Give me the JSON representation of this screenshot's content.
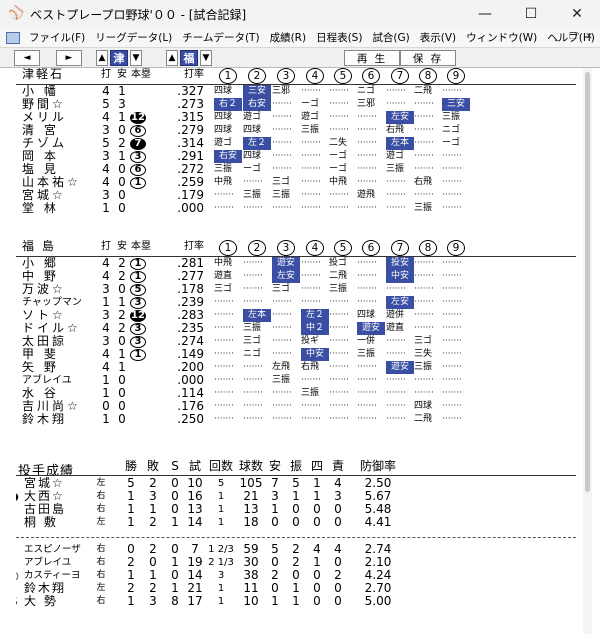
{
  "window": {
    "title": "ベストプレープロ野球'００ - [試合記録]",
    "icon": "baseball-cap-icon",
    "controls": [
      "minimize-icon",
      "maximize-icon",
      "close-icon"
    ]
  },
  "menu": [
    "ファイル(F)",
    "リーグデータ(L)",
    "チームデータ(T)",
    "成績(R)",
    "日程表(S)",
    "試合(G)",
    "表示(V)",
    "ウィンドウ(W)",
    "ヘルプ(H)"
  ],
  "toolbar": {
    "prev": "◄",
    "next": "►",
    "team1_arrow_up": "▲",
    "team1": "津",
    "team1_arrow_down": "▼",
    "team2_arrow_up": "▲",
    "team2": "福",
    "team2_arrow_down": "▼",
    "replay": "再 生",
    "save": "保 存"
  },
  "batting_headers": {
    "ab": "打",
    "h": "安",
    "hr": "本塁",
    "avg": "打率",
    "innings": [
      "1",
      "2",
      "3",
      "4",
      "5",
      "6",
      "7",
      "8",
      "9"
    ]
  },
  "team1": {
    "name": "津軽石",
    "players": [
      {
        "name": "小 幡",
        "ab": "4",
        "h": "1",
        "hr": "",
        "avg": ".327",
        "inn": [
          "四球",
          "三安",
          "三邪",
          "",
          "",
          "ニゴ",
          "",
          "二飛",
          ""
        ]
      },
      {
        "name": "野間☆",
        "ab": "5",
        "h": "3",
        "hr": "",
        "avg": ".273",
        "inn": [
          "右２",
          "右安",
          "",
          "ーゴ",
          "",
          "三邪",
          "",
          "",
          "三安"
        ]
      },
      {
        "name": "メリル",
        "ab": "4",
        "h": "1",
        "hr": "12",
        "avg": ".315",
        "inn": [
          "四球",
          "遊ゴ",
          "",
          "遊ゴ",
          "",
          "",
          "左安",
          "",
          "三振"
        ]
      },
      {
        "name": "清 宮",
        "ab": "3",
        "h": "0",
        "hr": "6",
        "avg": ".279",
        "inn": [
          "四球",
          "四球",
          "",
          "三振",
          "",
          "",
          "右飛",
          "",
          "ニゴ"
        ]
      },
      {
        "name": "チゾム",
        "ab": "5",
        "h": "2",
        "hr": "7",
        "avg": ".314",
        "inn": [
          "遊ゴ",
          "左２",
          "",
          "",
          "二失",
          "",
          "左本",
          "",
          "ーゴ"
        ]
      },
      {
        "name": "岡 本",
        "ab": "3",
        "h": "1",
        "hr": "3",
        "avg": ".291",
        "inn": [
          "右安",
          "四球",
          "",
          "",
          "ーゴ",
          "",
          "遊ゴ",
          "",
          ""
        ]
      },
      {
        "name": "塩 見",
        "ab": "4",
        "h": "0",
        "hr": "6",
        "avg": ".272",
        "inn": [
          "三振",
          "ーゴ",
          "",
          "",
          "ーゴ",
          "",
          "三振",
          "",
          ""
        ]
      },
      {
        "name": "山本祐☆",
        "ab": "4",
        "h": "0",
        "hr": "1",
        "avg": ".259",
        "inn": [
          "中飛",
          "",
          "三ゴ",
          "",
          "中飛",
          "",
          "",
          "右飛",
          ""
        ]
      },
      {
        "name": "宮城☆",
        "ab": "3",
        "h": "0",
        "hr": "",
        "avg": ".179",
        "inn": [
          "",
          "三振",
          "三振",
          "",
          "",
          "遊飛",
          "",
          "",
          ""
        ]
      },
      {
        "name": "堂 林",
        "ab": "1",
        "h": "0",
        "hr": "",
        "avg": ".000",
        "inn": [
          "",
          "",
          "",
          "",
          "",
          "",
          "",
          "三振",
          ""
        ]
      }
    ]
  },
  "team2": {
    "name": "福 島",
    "players": [
      {
        "name": "小 郷",
        "ab": "4",
        "h": "2",
        "hr": "1",
        "avg": ".281",
        "inn": [
          "中飛",
          "",
          "遊安",
          "",
          "投ゴ",
          "",
          "投安",
          "",
          ""
        ]
      },
      {
        "name": "中 野",
        "ab": "4",
        "h": "2",
        "hr": "1",
        "avg": ".277",
        "inn": [
          "遊直",
          "",
          "左安",
          "",
          "二飛",
          "",
          "中安",
          "",
          ""
        ]
      },
      {
        "name": "万波☆",
        "ab": "3",
        "h": "0",
        "hr": "5",
        "avg": ".178",
        "inn": [
          "三ゴ",
          "",
          "三ゴ",
          "",
          "三振",
          "",
          "",
          "",
          ""
        ]
      },
      {
        "name": "チャップマン",
        "ab": "1",
        "h": "1",
        "hr": "3",
        "avg": ".239",
        "inn": [
          "",
          "",
          "",
          "",
          "",
          "",
          "左安",
          "",
          ""
        ]
      },
      {
        "name": "ソト☆",
        "ab": "3",
        "h": "2",
        "hr": "12",
        "avg": ".283",
        "inn": [
          "",
          "左本",
          "",
          "左２",
          "",
          "四球",
          "遊併",
          "",
          ""
        ]
      },
      {
        "name": "ドイル☆",
        "ab": "4",
        "h": "2",
        "hr": "3",
        "avg": ".235",
        "inn": [
          "",
          "三振",
          "",
          "中２",
          "",
          "遊安",
          "遊直",
          "",
          ""
        ]
      },
      {
        "name": "太田諒",
        "ab": "3",
        "h": "0",
        "hr": "3",
        "avg": ".274",
        "inn": [
          "",
          "三ゴ",
          "",
          "投ギ",
          "",
          "一併",
          "",
          "三ゴ",
          ""
        ]
      },
      {
        "name": "甲 斐",
        "ab": "4",
        "h": "1",
        "hr": "1",
        "avg": ".149",
        "inn": [
          "",
          "ニゴ",
          "",
          "中安",
          "",
          "三振",
          "",
          "三失",
          ""
        ]
      },
      {
        "name": "矢 野",
        "ab": "4",
        "h": "1",
        "hr": "",
        "avg": ".200",
        "inn": [
          "",
          "",
          "左飛",
          "右飛",
          "",
          "",
          "遊安",
          "三振",
          ""
        ]
      },
      {
        "name": "アブレイユ",
        "ab": "1",
        "h": "0",
        "hr": "",
        "avg": ".000",
        "inn": [
          "",
          "",
          "三振",
          "",
          "",
          "",
          "",
          "",
          ""
        ]
      },
      {
        "name": "水 谷",
        "ab": "1",
        "h": "0",
        "hr": "",
        "avg": ".114",
        "inn": [
          "",
          "",
          "",
          "三振",
          "",
          "",
          "",
          "",
          ""
        ]
      },
      {
        "name": "吉川尚☆",
        "ab": "0",
        "h": "0",
        "hr": "",
        "avg": ".176",
        "inn": [
          "",
          "",
          "",
          "",
          "",
          "",
          "",
          "四球",
          ""
        ]
      },
      {
        "name": "鈴木翔",
        "ab": "1",
        "h": "0",
        "hr": "",
        "avg": ".250",
        "inn": [
          "",
          "",
          "",
          "",
          "",
          "",
          "",
          "二飛",
          ""
        ]
      }
    ]
  },
  "pitching": {
    "title": "投手成績",
    "headers": [
      "勝",
      "敗",
      "S",
      "試",
      "回数",
      "球数",
      "安",
      "振",
      "四",
      "責",
      "防御率"
    ],
    "team1": [
      {
        "mark": "",
        "name": "宮城☆",
        "hand": "左",
        "w": "5",
        "l": "2",
        "s": "0",
        "g": "10",
        "ip": "5",
        "pc": "105",
        "h": "7",
        "k": "5",
        "bb": "1",
        "er": "4",
        "era": "2.50"
      },
      {
        "mark": "●",
        "name": "大西☆",
        "hand": "右",
        "w": "1",
        "l": "3",
        "s": "0",
        "g": "16",
        "ip": "1",
        "pc": "21",
        "h": "3",
        "k": "1",
        "bb": "1",
        "er": "3",
        "era": "5.67"
      },
      {
        "mark": "",
        "name": "古田島",
        "hand": "右",
        "w": "1",
        "l": "1",
        "s": "0",
        "g": "13",
        "ip": "1",
        "pc": "13",
        "h": "1",
        "k": "0",
        "bb": "0",
        "er": "0",
        "era": "5.48"
      },
      {
        "mark": "",
        "name": "桐 敷",
        "hand": "左",
        "w": "1",
        "l": "2",
        "s": "1",
        "g": "14",
        "ip": "1",
        "pc": "18",
        "h": "0",
        "k": "0",
        "bb": "0",
        "er": "0",
        "era": "4.41"
      }
    ],
    "team2": [
      {
        "mark": "",
        "name": "エスピノーザ",
        "hand": "右",
        "w": "0",
        "l": "2",
        "s": "0",
        "g": "7",
        "ip": "1 2/3",
        "pc": "59",
        "h": "5",
        "k": "2",
        "bb": "4",
        "er": "4",
        "era": "2.74"
      },
      {
        "mark": "",
        "name": "アブレイユ",
        "hand": "右",
        "w": "2",
        "l": "0",
        "s": "1",
        "g": "19",
        "ip": "2 1/3",
        "pc": "30",
        "h": "0",
        "k": "2",
        "bb": "1",
        "er": "0",
        "era": "2.10"
      },
      {
        "mark": "○",
        "name": "カスティーヨ",
        "hand": "右",
        "w": "1",
        "l": "1",
        "s": "0",
        "g": "14",
        "ip": "3",
        "pc": "38",
        "h": "2",
        "k": "0",
        "bb": "0",
        "er": "2",
        "era": "4.24"
      },
      {
        "mark": "",
        "name": "鈴木翔",
        "hand": "左",
        "w": "2",
        "l": "2",
        "s": "1",
        "g": "21",
        "ip": "1",
        "pc": "11",
        "h": "0",
        "k": "1",
        "bb": "0",
        "er": "0",
        "era": "2.70"
      },
      {
        "mark": "S",
        "name": "大 勢",
        "hand": "右",
        "w": "1",
        "l": "3",
        "s": "8",
        "g": "17",
        "ip": "1",
        "pc": "10",
        "h": "1",
        "k": "1",
        "bb": "0",
        "er": "0",
        "era": "5.00"
      }
    ]
  }
}
